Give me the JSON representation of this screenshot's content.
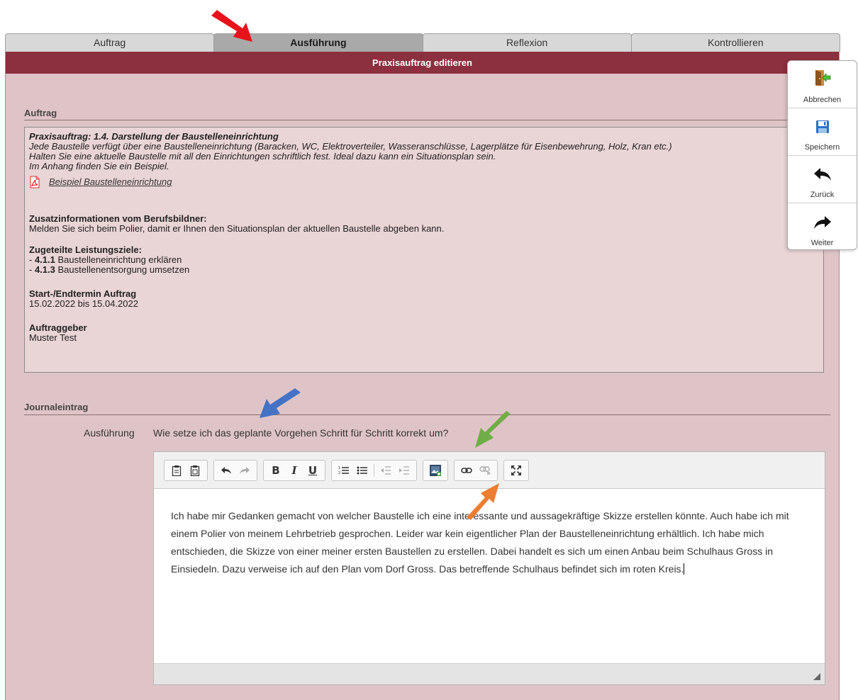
{
  "tabs": [
    {
      "label": "Auftrag"
    },
    {
      "label": "Ausführung"
    },
    {
      "label": "Reflexion"
    },
    {
      "label": "Kontrollieren"
    }
  ],
  "panel": {
    "title": "Praxisauftrag editieren"
  },
  "auftrag": {
    "section_title": "Auftrag",
    "heading": "Praxisauftrag: 1.4. Darstellung der Baustelleneinrichtung",
    "lines": [
      "Jede Baustelle verfügt über eine Baustelleneinrichtung (Baracken, WC, Elektroverteiler, Wasseranschlüsse, Lagerplätze für Eisenbewehrung, Holz, Kran etc.)",
      "Halten Sie eine aktuelle Baustelle mit all den Einrichtungen schriftlich fest. Ideal dazu kann ein Situationsplan sein.",
      "Im Anhang finden Sie ein Beispiel."
    ],
    "attachment": "Beispiel Baustelleneinrichtung",
    "zusatz_title": "Zusatzinformationen vom Berufsbildner:",
    "zusatz_text": "Melden Sie sich beim Polier, damit er Ihnen den Situationsplan der aktuellen Baustelle abgeben kann.",
    "ziele_title": "Zugeteilte Leistungsziele:",
    "ziele": [
      {
        "code": "4.1.1",
        "text": "Baustelleneinrichtung erklären"
      },
      {
        "code": "4.1.3",
        "text": "Baustellenentsorgung umsetzen"
      }
    ],
    "dash": "- ",
    "termin_title": "Start-/Endtermin Auftrag",
    "termin_text": "15.02.2022 bis 15.04.2022",
    "geber_title": "Auftraggeber",
    "geber_text": "Muster Test"
  },
  "journal": {
    "section_title": "Journaleintrag",
    "label": "Ausführung",
    "question": "Wie setze ich das geplante Vorgehen Schritt für Schritt korrekt um?",
    "text": "Ich habe mir Gedanken gemacht von welcher Baustelle ich eine interessante und aussagekräftige Skizze erstellen könnte. Auch habe ich mit einem Polier von meinem Lehrbetrieb gesprochen. Leider war kein eigentlicher Plan der Baustelleneinrichtung erhältlich. Ich habe mich entschieden, die Skizze von einer meiner ersten Baustellen zu erstellen. Dabei handelt es sich um einen Anbau beim Schulhaus Gross in Einsiedeln. Dazu verweise ich auf den Plan vom Dorf Gross. Das betreffende Schulhaus befindet sich im roten Kreis."
  },
  "toolbar": {
    "bold": "B",
    "italic": "I",
    "underline": "U"
  },
  "side_actions": [
    {
      "label": "Abbrechen",
      "icon": "exit-door-icon"
    },
    {
      "label": "Speichern",
      "icon": "floppy-disk-icon"
    },
    {
      "label": "Zurück",
      "icon": "back-arrow-icon"
    },
    {
      "label": "Weiter",
      "icon": "forward-arrow-icon"
    }
  ],
  "colors": {
    "header": "#8c2f3e",
    "panel": "#dfc4c7",
    "arrow_red": "#e8121b",
    "arrow_blue": "#4472c4",
    "arrow_green": "#70ad47",
    "arrow_orange": "#ed7d31"
  }
}
